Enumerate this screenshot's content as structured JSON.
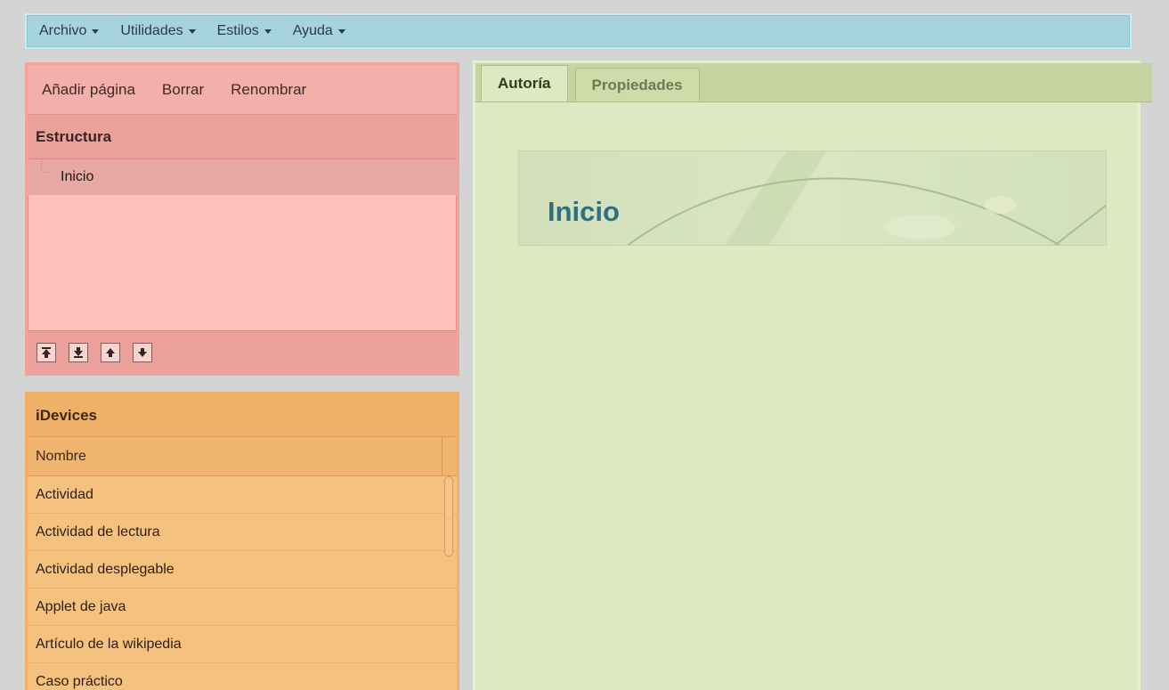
{
  "menubar": {
    "items": [
      {
        "label": "Archivo"
      },
      {
        "label": "Utilidades"
      },
      {
        "label": "Estilos"
      },
      {
        "label": "Ayuda"
      }
    ]
  },
  "structure": {
    "toolbar": {
      "add_page": "Añadir página",
      "delete": "Borrar",
      "rename": "Renombrar"
    },
    "header": "Estructura",
    "tree": [
      {
        "label": "Inicio"
      }
    ],
    "move_buttons": [
      "move-top-icon",
      "move-bottom-icon",
      "move-up-icon",
      "move-down-icon"
    ]
  },
  "idevices": {
    "header": "iDevices",
    "column": "Nombre",
    "items": [
      "Actividad",
      "Actividad de lectura",
      "Actividad desplegable",
      "Applet de java",
      "Artículo de la wikipedia",
      "Caso práctico"
    ]
  },
  "main": {
    "tabs": [
      {
        "label": "Autoría",
        "active": true
      },
      {
        "label": "Propiedades",
        "active": false
      }
    ],
    "page_title": "Inicio"
  },
  "colors": {
    "menubar": "#a7d3de",
    "structure_panel": "#fec0b9",
    "idevices_panel": "#f5c17f",
    "main_panel": "#dde9c0",
    "title_text": "#2e6f82"
  }
}
